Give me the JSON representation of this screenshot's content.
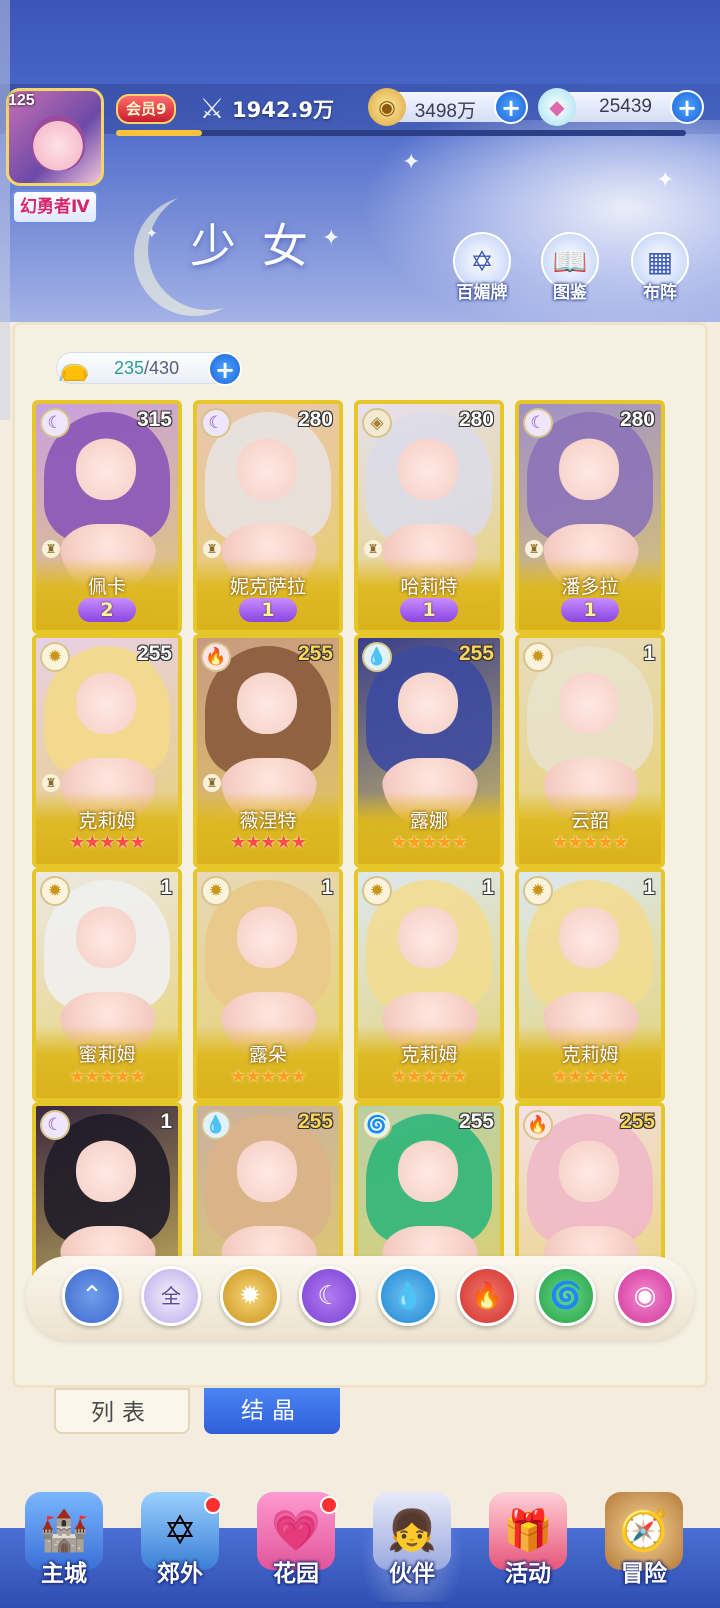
{
  "player": {
    "level": "125",
    "title": "幻勇者Ⅳ",
    "vip": "会员9",
    "power": "1942.9万",
    "exp_fraction": 0.15
  },
  "resources": {
    "gold": "3498万",
    "gems": "25439"
  },
  "page_title": "少女",
  "top_buttons": {
    "baimei": "百媚牌",
    "tujian": "图鉴",
    "buzhen": "布阵"
  },
  "capacity": {
    "current": "235",
    "max": "/430"
  },
  "cards": [
    {
      "name": "佩卡",
      "level": "315",
      "element": "moon",
      "rank": "2",
      "stars": 0
    },
    {
      "name": "妮克萨拉",
      "level": "280",
      "element": "moon",
      "rank": "1",
      "stars": 0
    },
    {
      "name": "哈莉特",
      "level": "280",
      "element": "diamond",
      "rank": "1",
      "stars": 0
    },
    {
      "name": "潘多拉",
      "level": "280",
      "element": "moon",
      "rank": "1",
      "stars": 0
    },
    {
      "name": "克莉姆",
      "level": "255",
      "element": "sun",
      "stars": 5,
      "star_color": "red"
    },
    {
      "name": "薇涅特",
      "level": "255",
      "element": "fire",
      "stars": 5,
      "star_color": "red"
    },
    {
      "name": "露娜",
      "level": "255",
      "element": "water",
      "stars": 5,
      "star_color": "gold"
    },
    {
      "name": "云韶",
      "level": "1",
      "element": "sun",
      "stars": 5,
      "star_color": "gold"
    },
    {
      "name": "蜜莉姆",
      "level": "1",
      "element": "sun",
      "stars": 5,
      "star_color": "gold"
    },
    {
      "name": "露朵",
      "level": "1",
      "element": "sun",
      "stars": 5,
      "star_color": "gold"
    },
    {
      "name": "克莉姆",
      "level": "1",
      "element": "sun",
      "stars": 5,
      "star_color": "gold"
    },
    {
      "name": "克莉姆",
      "level": "1",
      "element": "sun",
      "stars": 5,
      "star_color": "gold"
    },
    {
      "name": "",
      "level": "1",
      "element": "moon"
    },
    {
      "name": "",
      "level": "255",
      "element": "water"
    },
    {
      "name": "",
      "level": "255",
      "element": "wind"
    },
    {
      "name": "",
      "level": "255",
      "element": "fire"
    }
  ],
  "filters": [
    {
      "id": "sort",
      "label": "",
      "icon": "chevron-up-icon"
    },
    {
      "id": "all",
      "label": "全",
      "icon": ""
    },
    {
      "id": "sun",
      "label": "",
      "icon": "sun-icon"
    },
    {
      "id": "moon",
      "label": "",
      "icon": "moon-icon"
    },
    {
      "id": "water",
      "label": "",
      "icon": "water-icon"
    },
    {
      "id": "fire",
      "label": "",
      "icon": "fire-icon"
    },
    {
      "id": "wind",
      "label": "",
      "icon": "wind-icon"
    },
    {
      "id": "special",
      "label": "",
      "icon": "orb-icon"
    }
  ],
  "tabs": {
    "list": "列表",
    "crystal": "结晶"
  },
  "nav": [
    {
      "label": "主城",
      "badge": false
    },
    {
      "label": "郊外",
      "badge": true
    },
    {
      "label": "花园",
      "badge": true
    },
    {
      "label": "伙伴",
      "badge": false
    },
    {
      "label": "活动",
      "badge": false
    },
    {
      "label": "冒险",
      "badge": false
    }
  ],
  "colors": {
    "banner_blue": "#4a69c9",
    "card_gold": "#e6c629",
    "accent_blue": "#1b62d9",
    "purple_wing": "#8a45e2"
  }
}
